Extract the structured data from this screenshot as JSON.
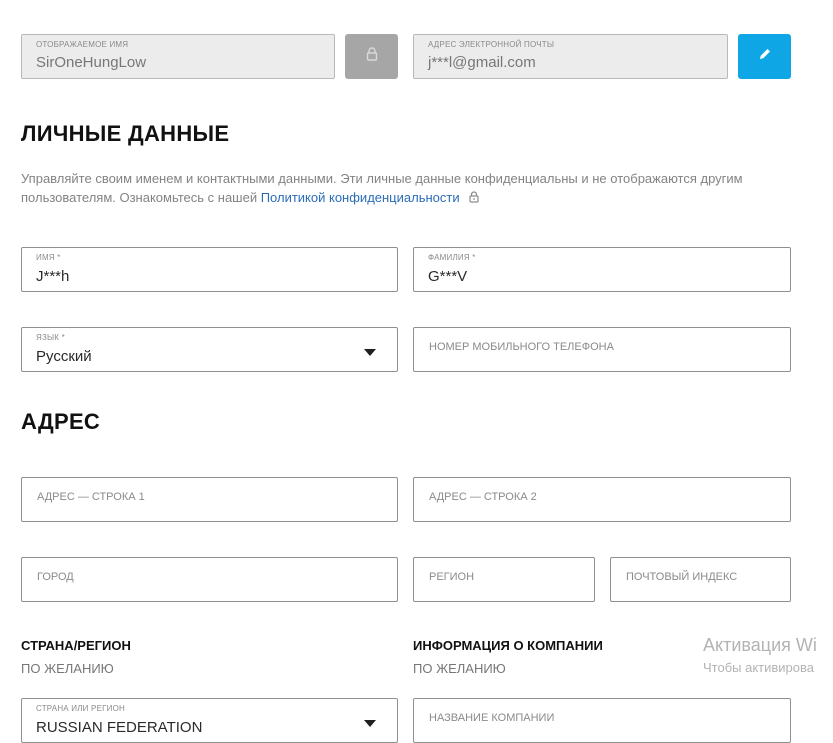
{
  "account": {
    "display_name_label": "ОТОБРАЖАЕМОЕ ИМЯ",
    "display_name_value": "SirOneHungLow",
    "email_label": "АДРЕС ЭЛЕКТРОННОЙ ПОЧТЫ",
    "email_value": "j***l@gmail.com"
  },
  "personal": {
    "heading": "ЛИЧНЫЕ ДАННЫЕ",
    "desc_text": "Управляйте своим именем и контактными данными. Эти личные данные конфиденциальны и не отображаются другим пользователям. Ознакомьтесь с нашей ",
    "privacy_link": "Политикой конфиденциальности",
    "first_name_label": "ИМЯ *",
    "first_name_value": "J***h",
    "last_name_label": "ФАМИЛИЯ *",
    "last_name_value": "G***V",
    "language_label": "ЯЗЫК *",
    "language_value": "Русский",
    "phone_placeholder": "НОМЕР МОБИЛЬНОГО ТЕЛЕФОНА"
  },
  "address": {
    "heading": "АДРЕС",
    "line1_placeholder": "АДРЕС — СТРОКА 1",
    "line2_placeholder": "АДРЕС — СТРОКА 2",
    "city_placeholder": "ГОРОД",
    "region_placeholder": "РЕГИОН",
    "postal_placeholder": "ПОЧТОВЫЙ ИНДЕКС"
  },
  "country": {
    "heading": "СТРАНА/РЕГИОН",
    "optional": "ПО ЖЕЛАНИЮ",
    "field_label": "СТРАНА ИЛИ РЕГИОН",
    "field_value": "RUSSIAN FEDERATION"
  },
  "company": {
    "heading": "ИНФОРМАЦИЯ О КОМПАНИИ",
    "optional": "ПО ЖЕЛАНИЮ",
    "name_placeholder": "НАЗВАНИЕ КОМПАНИИ"
  },
  "watermark": {
    "line1": "Активация Wi",
    "line2": "Чтобы активирова"
  },
  "colors": {
    "edit_button": "#0fa6e6",
    "lock_button": "#a6a6a6",
    "link": "#2a6db8"
  },
  "icons": {
    "lock": "lock-icon",
    "edit": "pencil-icon",
    "dropdown": "chevron-down-icon"
  }
}
